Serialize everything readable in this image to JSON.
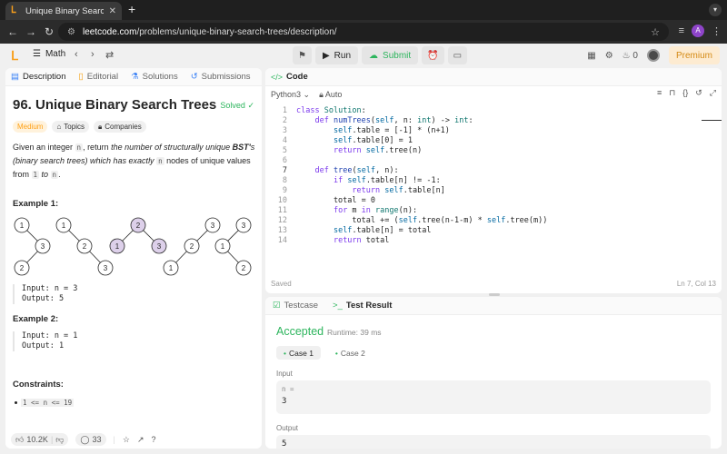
{
  "browser": {
    "tab_title": "Unique Binary Search Trees",
    "url_host": "leetcode.com",
    "url_path": "/problems/unique-binary-search-trees/description/",
    "avatar_letter": "A"
  },
  "lcnav": {
    "problem_list": "Math",
    "run": "Run",
    "submit": "Submit",
    "streak": "0",
    "premium": "Premium"
  },
  "left": {
    "tabs": [
      "Description",
      "Editorial",
      "Solutions",
      "Submissions"
    ],
    "title": "96. Unique Binary Search Trees",
    "solved": "Solved",
    "chips": [
      "Medium",
      "Topics",
      "Companies"
    ],
    "desc": {
      "p1": "Given an integer ",
      "n1": "n",
      "p2": ", return ",
      "i1": "the number of structurally unique ",
      "b1": "BST'",
      "i2": "s (binary search trees) which has exactly ",
      "n2": "n",
      "i3": " nodes of unique values from ",
      "one": "1",
      "i4": " to ",
      "n3": "n",
      "p3": "."
    },
    "example1": "Example 1:",
    "ex1_input": "Input: n = 3",
    "ex1_output": "Output: 5",
    "example2": "Example 2:",
    "ex2_input": "Input: n = 1",
    "ex2_output": "Output: 1",
    "constraints": "Constraints:",
    "constraint1": "1 <= n <= 19",
    "likes": "10.2K",
    "comments": "33",
    "trees": [
      {
        "nodes": [
          "1",
          "3",
          "2"
        ]
      },
      {
        "nodes": [
          "1",
          "2",
          "3"
        ]
      },
      {
        "nodes": [
          "2",
          "1",
          "3"
        ]
      },
      {
        "nodes": [
          "3",
          "2",
          "1"
        ]
      },
      {
        "nodes": [
          "3",
          "1",
          "2"
        ]
      }
    ]
  },
  "code": {
    "header": "Code",
    "language": "Python3",
    "auto": "Auto",
    "saved": "Saved",
    "cursor": "Ln 7, Col 13",
    "line_numbers": [
      "1",
      "2",
      "3",
      "4",
      "5",
      "6",
      "7",
      "8",
      "9",
      "10",
      "11",
      "12",
      "13",
      "14"
    ]
  },
  "result": {
    "tab_testcase": "Testcase",
    "tab_result": "Test Result",
    "status": "Accepted",
    "runtime": "Runtime: 39 ms",
    "case1": "Case 1",
    "case2": "Case 2",
    "input_label": "Input",
    "input_key": "n =",
    "input_val": "3",
    "output_label": "Output",
    "output_val": "5"
  }
}
